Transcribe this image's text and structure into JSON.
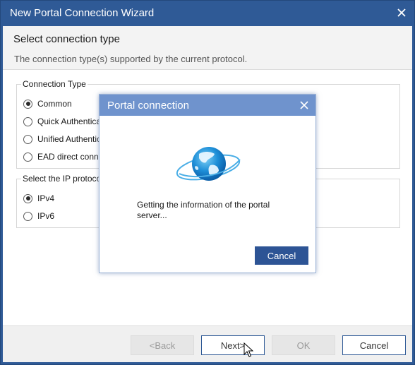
{
  "window": {
    "title": "New Portal Connection Wizard",
    "close_icon": "close-icon"
  },
  "header": {
    "title": "Select connection type",
    "subtitle": "The connection type(s) supported by the current protocol."
  },
  "connection_type": {
    "legend": "Connection Type",
    "options": [
      {
        "label": "Common",
        "checked": true
      },
      {
        "label": "Quick Authentication",
        "checked": false
      },
      {
        "label": "Unified Authentication",
        "checked": false
      },
      {
        "label": "EAD direct connection",
        "checked": false
      }
    ]
  },
  "ip_protocol": {
    "legend": "Select the IP protocol",
    "options": [
      {
        "label": "IPv4",
        "checked": true
      },
      {
        "label": "IPv6",
        "checked": false
      }
    ]
  },
  "footer": {
    "back_label": "<Back",
    "next_label": "Next>",
    "ok_label": "OK",
    "cancel_label": "Cancel"
  },
  "modal": {
    "title": "Portal connection",
    "message_line1": "Getting the information of the portal",
    "message_line2": "server...",
    "cancel_label": "Cancel",
    "icon": "globe-icon"
  },
  "colors": {
    "titlebar": "#2f5a96",
    "modal_titlebar": "#6f93cd",
    "primary_button": "#2d5495"
  }
}
